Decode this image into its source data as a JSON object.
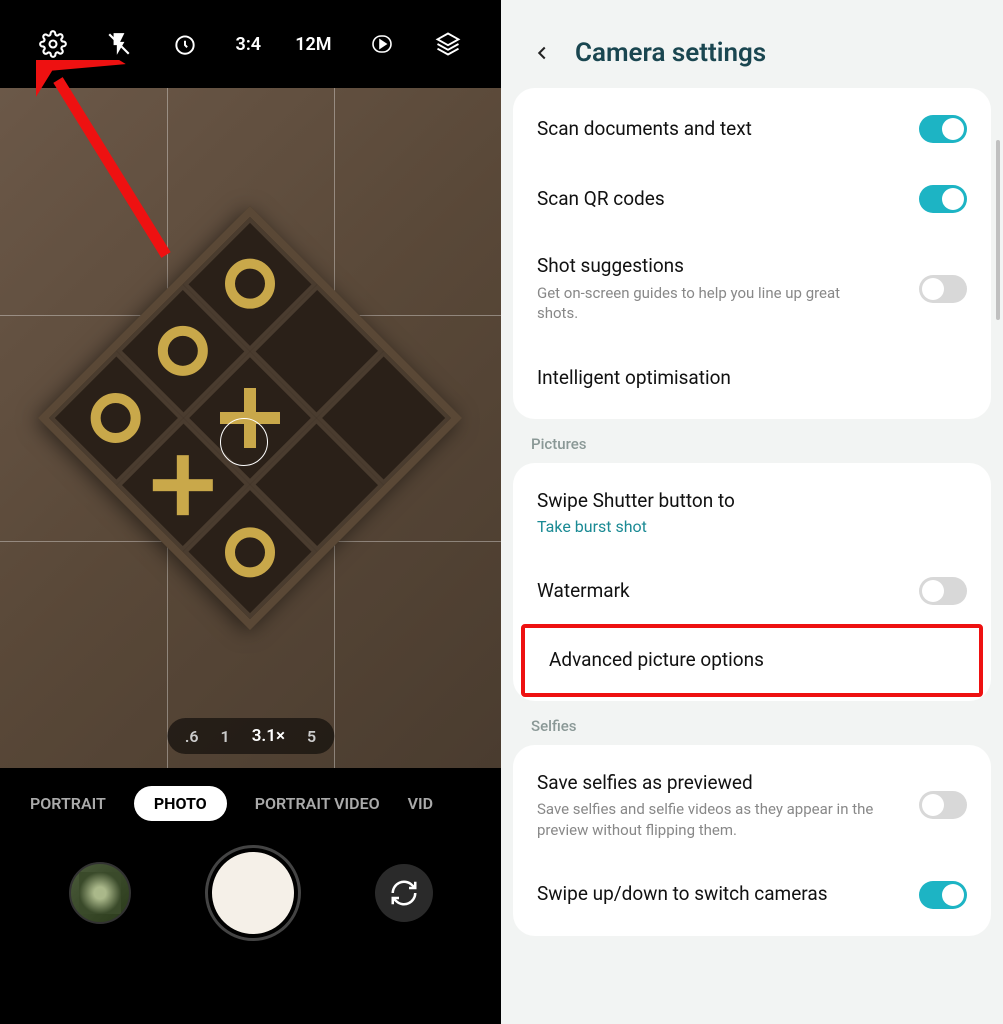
{
  "camera": {
    "topbar": {
      "ratio": "3:4",
      "resolution": "12M"
    },
    "zoom": {
      "levels": [
        ".6",
        "1",
        "3.1×",
        "5"
      ],
      "active_index": 2
    },
    "modes": {
      "items": [
        "PORTRAIT",
        "PHOTO",
        "PORTRAIT VIDEO",
        "VID"
      ],
      "active_index": 1
    }
  },
  "settings": {
    "title": "Camera settings",
    "group1": [
      {
        "title": "Scan documents and text",
        "toggle": true
      },
      {
        "title": "Scan QR codes",
        "toggle": true
      },
      {
        "title": "Shot suggestions",
        "sub": "Get on-screen guides to help you line up great shots.",
        "toggle": false
      },
      {
        "title": "Intelligent optimisation"
      }
    ],
    "pictures_label": "Pictures",
    "group2": [
      {
        "title": "Swipe Shutter button to",
        "sub_teal": "Take burst shot"
      },
      {
        "title": "Watermark",
        "toggle": false
      },
      {
        "title": "Advanced picture options",
        "highlight": true
      }
    ],
    "selfies_label": "Selfies",
    "group3": [
      {
        "title": "Save selfies as previewed",
        "sub": "Save selfies and selfie videos as they appear in the preview without flipping them.",
        "toggle": false
      },
      {
        "title": "Swipe up/down to switch cameras",
        "toggle": true
      }
    ]
  }
}
